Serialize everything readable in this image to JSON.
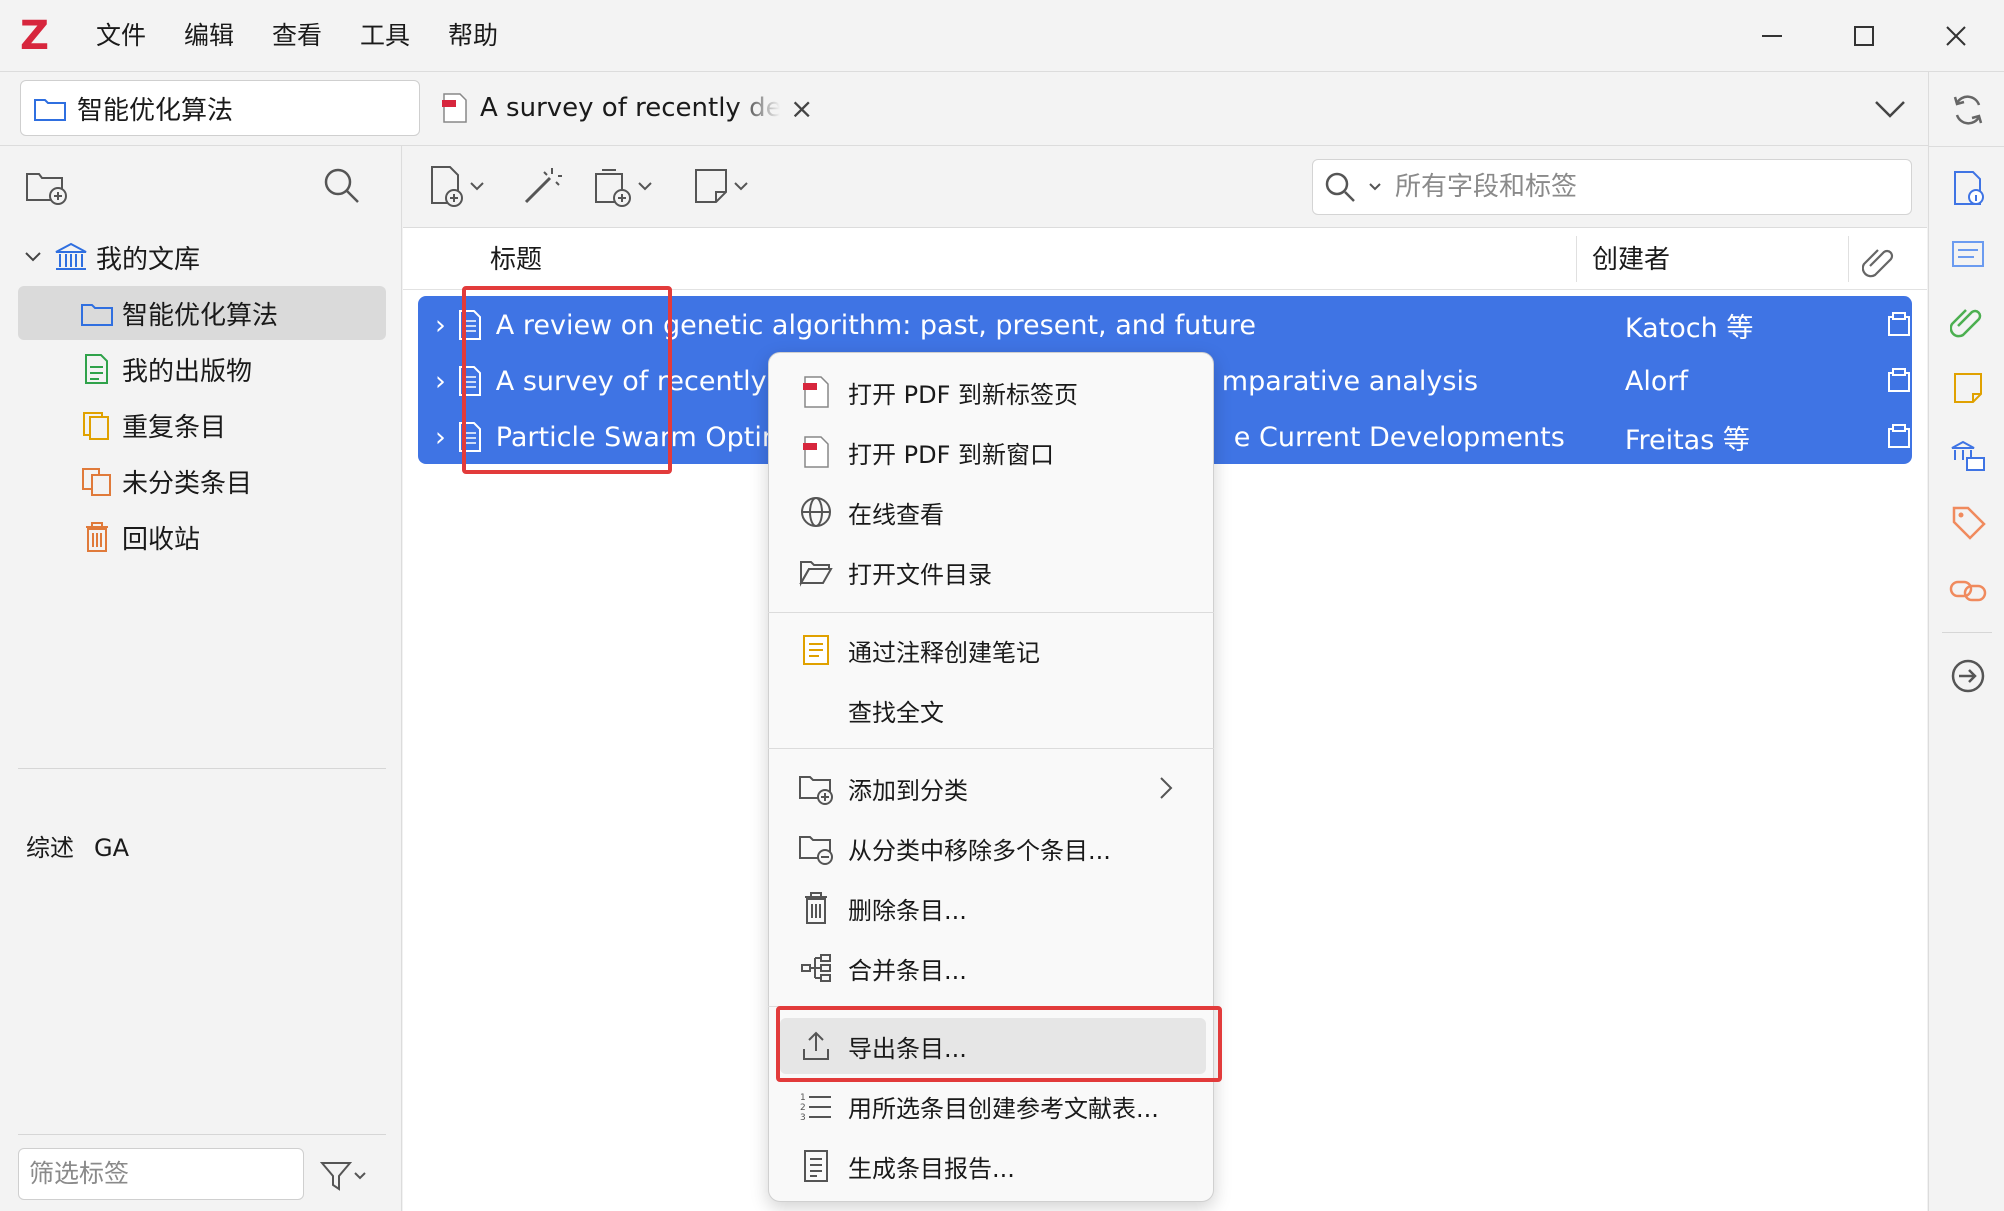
{
  "app": {
    "logo": "Z"
  },
  "menubar": {
    "items": [
      "文件",
      "编辑",
      "查看",
      "工具",
      "帮助"
    ]
  },
  "tabs": {
    "library": "智能优化算法",
    "reader": "A survey of recently dev"
  },
  "left": {
    "library_root": "我的文库",
    "collections": [
      {
        "label": "智能优化算法",
        "icon": "folder-icon",
        "color": "#2f6fe0"
      },
      {
        "label": "我的出版物",
        "icon": "publication-icon",
        "color": "#2fa24a"
      },
      {
        "label": "重复条目",
        "icon": "duplicate-icon",
        "color": "#e0a100"
      },
      {
        "label": "未分类条目",
        "icon": "unfiled-icon",
        "color": "#e07a3a"
      },
      {
        "label": "回收站",
        "icon": "trash-icon",
        "color": "#e07a3a"
      }
    ],
    "tags": [
      "综述",
      "GA"
    ],
    "tag_filter_placeholder": "筛选标签"
  },
  "search": {
    "placeholder": "所有字段和标签"
  },
  "columns": {
    "title": "标题",
    "creator": "创建者"
  },
  "items": [
    {
      "title": "A review on genetic algorithm: past, present, and future",
      "creator": "Katoch 等"
    },
    {
      "title_left": "A survey of recently de",
      "title_right": "mparative analysis",
      "creator": "Alorf"
    },
    {
      "title_left": "Particle Swarm Optimi",
      "title_right": "e Current Developments",
      "creator": "Freitas 等"
    }
  ],
  "context_menu": {
    "group1": [
      "打开 PDF 到新标签页",
      "打开 PDF 到新窗口",
      "在线查看",
      "打开文件目录"
    ],
    "group2": [
      "通过注释创建笔记",
      "查找全文"
    ],
    "group3": [
      "添加到分类",
      "从分类中移除多个条目...",
      "删除条目...",
      "合并条目..."
    ],
    "group4": [
      "导出条目...",
      "用所选条目创建参考文献表...",
      "生成条目报告..."
    ]
  },
  "colors": {
    "selection": "#3f74e4",
    "highlight_box": "#e23b3b",
    "logo": "#d7263d"
  }
}
